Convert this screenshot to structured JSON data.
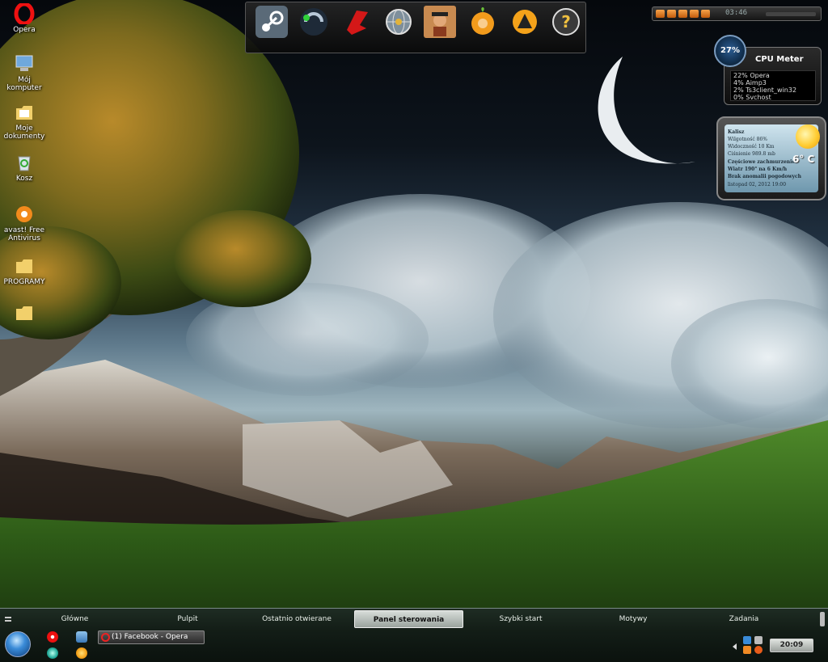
{
  "desktop": {
    "icons": [
      {
        "label": "Opera"
      },
      {
        "label": "Mój komputer"
      },
      {
        "label": "Moje dokumenty"
      },
      {
        "label": "Kosz"
      },
      {
        "label": "avast! Free Antivirus"
      },
      {
        "label": "PROGRAMY"
      },
      {
        "label": ""
      }
    ]
  },
  "dock": {
    "items": [
      {
        "icon": "steam-icon"
      },
      {
        "icon": "ts3-icon"
      },
      {
        "icon": "winamp-icon"
      },
      {
        "icon": "network-globe-icon"
      },
      {
        "icon": "game-character-icon"
      },
      {
        "icon": "fruity-loops-icon"
      },
      {
        "icon": "aimp-icon"
      },
      {
        "icon": "help-icon"
      }
    ]
  },
  "media_player": {
    "time": "03:46",
    "accent": "#f08a24"
  },
  "cpu_meter": {
    "percent": "27%",
    "title": "CPU Meter",
    "processes": [
      "22% Opera",
      "4% Aimp3",
      "2% Ts3client_win32",
      "0% Svchost"
    ]
  },
  "weather": {
    "lines": [
      "Kalisz",
      "Wilgotność 86%",
      "Widoczność 10 Km",
      "Ciśnienie 989.8 mb",
      "Częściowe zachmurzenie",
      "Wiatr 190° na 6 Km/h",
      "Brak anomalii pogodowych",
      "listopad 02, 2012 19:00"
    ],
    "temperature": "6° C"
  },
  "taskbar": {
    "menu": [
      {
        "label": "Główne",
        "active": false
      },
      {
        "label": "Pulpit",
        "active": false
      },
      {
        "label": "Ostatnio otwierane",
        "active": false
      },
      {
        "label": "Panel sterowania",
        "active": true
      },
      {
        "label": "Szybki start",
        "active": false
      },
      {
        "label": "Motywy",
        "active": false
      },
      {
        "label": "Zadania",
        "active": false
      }
    ],
    "window_button": "(1) Facebook - Opera",
    "clock": "20:09"
  }
}
